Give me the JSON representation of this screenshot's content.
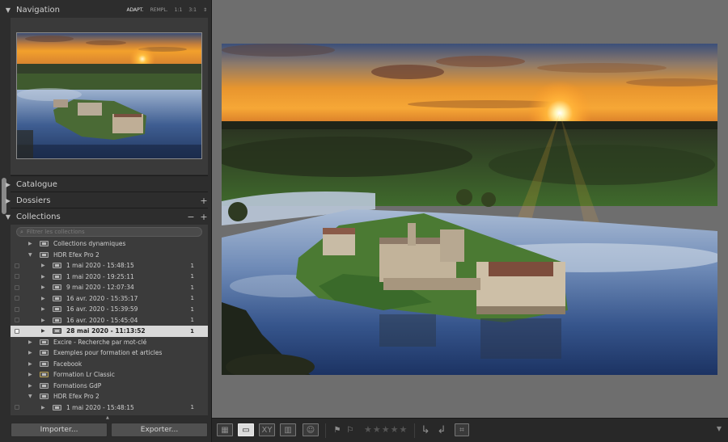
{
  "navigation": {
    "title": "Navigation",
    "zoom_options": [
      "ADAPT.",
      "REMPL.",
      "1:1",
      "3:1"
    ],
    "zoom_active": "ADAPT.",
    "zoom_arrows": "⇕"
  },
  "panels": {
    "catalogue": "Catalogue",
    "dossiers": "Dossiers",
    "collections": "Collections"
  },
  "collections": {
    "filter_placeholder": "Filtrer les collections",
    "rows": [
      {
        "label": "Collections dynamiques",
        "level": 0,
        "expanded": false,
        "count": ""
      },
      {
        "label": "HDR Efex Pro 2",
        "level": 0,
        "expanded": true,
        "count": ""
      },
      {
        "label": "1 mai 2020 - 15:48:15",
        "level": 1,
        "expanded": false,
        "count": "1"
      },
      {
        "label": "1 mai 2020 - 19:25:11",
        "level": 1,
        "expanded": false,
        "count": "1"
      },
      {
        "label": "9 mai 2020 - 12:07:34",
        "level": 1,
        "expanded": false,
        "count": "1"
      },
      {
        "label": "16 avr. 2020 - 15:35:17",
        "level": 1,
        "expanded": false,
        "count": "1"
      },
      {
        "label": "16 avr. 2020 - 15:39:59",
        "level": 1,
        "expanded": false,
        "count": "1"
      },
      {
        "label": "16 avr. 2020 - 15:45:04",
        "level": 1,
        "expanded": false,
        "count": "1"
      },
      {
        "label": "28 mai 2020 - 11:13:52",
        "level": 1,
        "expanded": false,
        "count": "1",
        "selected": true
      },
      {
        "label": "Excire - Recherche par mot-clé",
        "level": 0,
        "expanded": false,
        "count": ""
      },
      {
        "label": "Exemples pour formation et articles",
        "level": 0,
        "expanded": false,
        "count": ""
      },
      {
        "label": "Facebook",
        "level": 0,
        "expanded": false,
        "count": ""
      },
      {
        "label": "Formation Lr Classic",
        "level": 0,
        "expanded": false,
        "count": "",
        "smart": true
      },
      {
        "label": "Formations GdP",
        "level": 0,
        "expanded": false,
        "count": ""
      },
      {
        "label": "HDR Efex Pro 2",
        "level": 0,
        "expanded": true,
        "count": ""
      },
      {
        "label": "1 mai 2020 - 15:48:15",
        "level": 1,
        "expanded": false,
        "count": "1"
      }
    ]
  },
  "buttons": {
    "import": "Importer...",
    "export": "Exporter..."
  },
  "toolbar": {
    "stars": "★★★★★",
    "icons": [
      "grid-view-icon",
      "loupe-view-icon",
      "compare-view-icon",
      "survey-view-icon",
      "people-view-icon",
      "flag-pick-icon",
      "flag-reject-icon",
      "rotate-left-icon",
      "rotate-right-icon",
      "crop-overlay-icon",
      "toolbar-menu-icon"
    ]
  },
  "colors": {
    "panel_bg": "#2d2d2d",
    "canvas_bg": "#6e6e6e",
    "selection_bg": "#d9d9d9"
  }
}
